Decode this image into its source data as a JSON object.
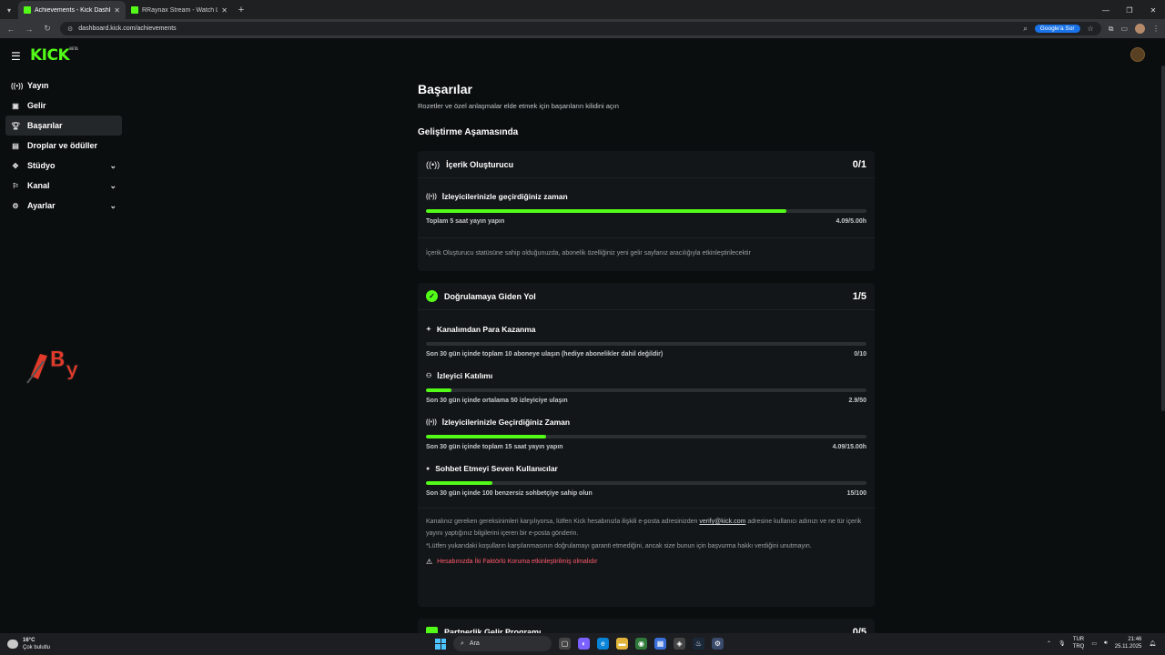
{
  "browser": {
    "tabs": [
      {
        "title": "Achievements - Kick Dashboard",
        "active": true
      },
      {
        "title": "RRaynax Stream - Watch Live o",
        "active": false
      }
    ],
    "url": "dashboard.kick.com/achievements",
    "google_button": "Google'a Sor"
  },
  "header": {
    "logo": "KICK",
    "logo_tag": "BETA"
  },
  "sidebar": {
    "items": [
      {
        "label": "Yayın",
        "icon": "broadcast-icon"
      },
      {
        "label": "Gelir",
        "icon": "wallet-icon"
      },
      {
        "label": "Başarılar",
        "icon": "trophy-icon",
        "active": true
      },
      {
        "label": "Droplar ve ödüller",
        "icon": "gift-icon"
      },
      {
        "label": "Stüdyo",
        "icon": "studio-icon",
        "expandable": true
      },
      {
        "label": "Kanal",
        "icon": "channel-icon",
        "expandable": true
      },
      {
        "label": "Ayarlar",
        "icon": "gear-icon",
        "expandable": true
      }
    ]
  },
  "main": {
    "title": "Başarılar",
    "subtitle": "Rozetler ve özel anlaşmalar elde etmek için başarıların kilidini açın",
    "section_title": "Geliştirme Aşamasında",
    "cards": [
      {
        "title": "İçerik Oluşturucu",
        "count": "0/1",
        "requirements": [
          {
            "title": "İzleyicilerinizle geçirdiğiniz zaman",
            "desc": "Toplam 5 saat yayın yapın",
            "value": "4.09/5.00h",
            "progress": 0.818
          }
        ],
        "note": "İçerik Oluşturucu statüsüne sahip olduğunuzda, abonelik özelliğiniz yeni gelir sayfanız aracılığıyla etkinleştirilecektir"
      },
      {
        "title": "Doğrulamaya Giden Yol",
        "count": "1/5",
        "requirements": [
          {
            "title": "Kanalımdan Para Kazanma",
            "desc": "Son 30 gün içinde toplam 10 aboneye ulaşın (hediye abonelikler dahil değildir)",
            "value": "0/10",
            "progress": 0
          },
          {
            "title": "İzleyici Katılımı",
            "desc": "Son 30 gün içinde ortalama 50 izleyiciye ulaşın",
            "value": "2.9/50",
            "progress": 0.058
          },
          {
            "title": "İzleyicilerinizle Geçirdiğiniz Zaman",
            "desc": "Son 30 gün içinde toplam 15 saat yayın yapın",
            "value": "4.09/15.00h",
            "progress": 0.273
          },
          {
            "title": "Sohbet Etmeyi Seven Kullanıcılar",
            "desc": "Son 30 gün içinde 100 benzersiz sohbetçiye sahip olun",
            "value": "15/100",
            "progress": 0.15
          }
        ],
        "note_pre": "Kanalınız gereken gereksinimleri karşılıyorsa, lütfen Kick hesabınızla ilişkili e-posta adresinizden",
        "note_email": "verify@kick.com",
        "note_post": "adresine kullanıcı adınızı ve ne tür içerik yayını yaptığınız bilgilerini içeren bir e-posta gönderin.",
        "note2": "*Lütfen yukarıdaki koşulların karşılanmasının doğrulamayı garanti etmediğini, ancak size bunun için başvurma hakkı verdiğini unutmayın.",
        "warning": "Hesabınızda İki Faktörlü Koruma etkinleştirilmiş olmalıdır"
      },
      {
        "title": "Partnerlik Gelir Programı",
        "count": "0/5"
      }
    ]
  },
  "taskbar": {
    "weather_temp": "16°C",
    "weather_desc": "Çok bulutlu",
    "search": "Ara",
    "lang1": "TUR",
    "lang2": "TRQ",
    "time": "21:46",
    "date": "25.11.2025"
  },
  "colors": {
    "accent": "#53fc18",
    "warning": "#ff5a6e",
    "bg": "#0b0e0f",
    "card": "#131618"
  }
}
